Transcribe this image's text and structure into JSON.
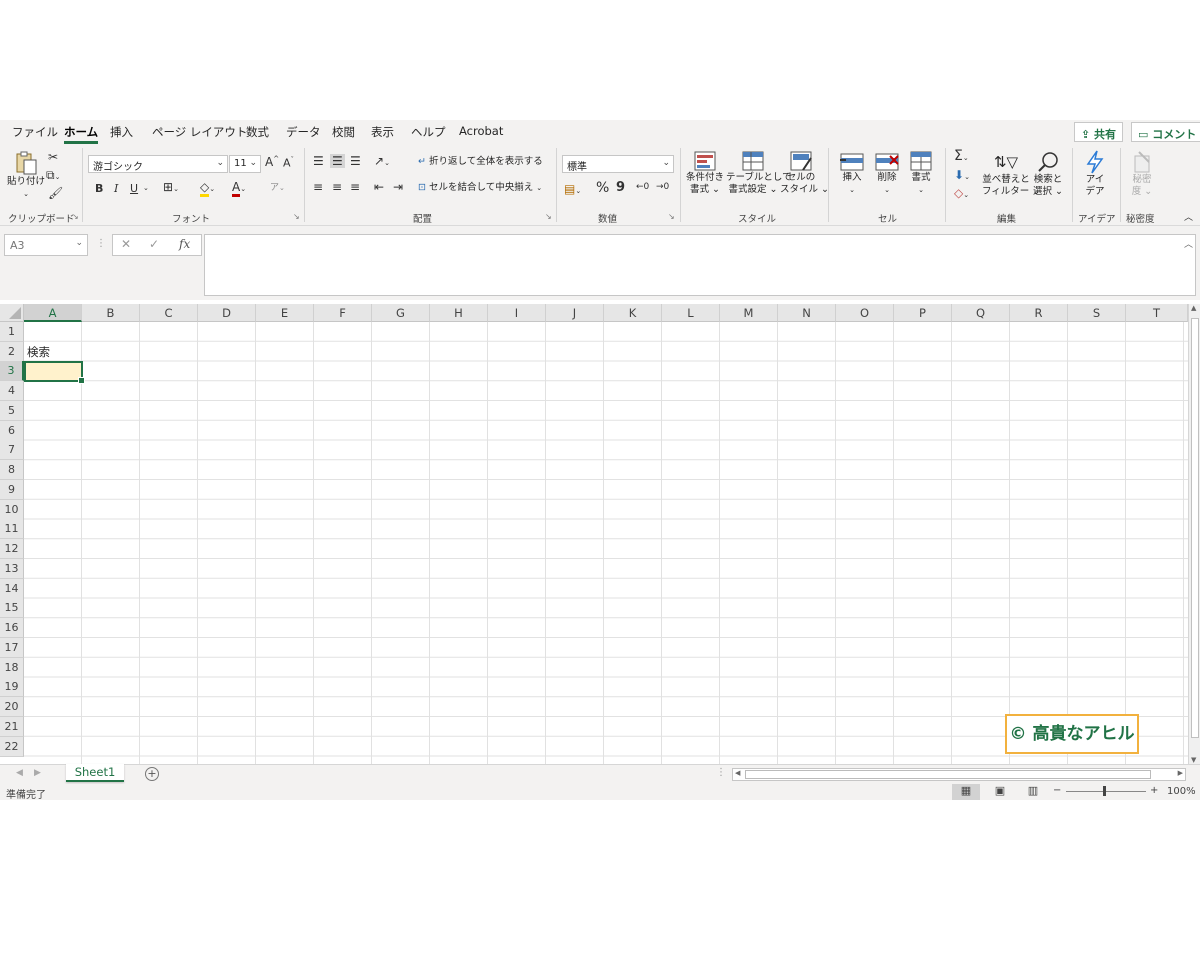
{
  "menu": {
    "tabs": [
      "ファイル",
      "ホーム",
      "挿入",
      "ページ レイアウト",
      "数式",
      "データ",
      "校閲",
      "表示",
      "ヘルプ",
      "Acrobat"
    ],
    "active_tab": "ホーム",
    "share_label": "共有",
    "comment_label": "コメント"
  },
  "ribbon": {
    "clipboard": {
      "paste_label": "貼り付け",
      "group_label": "クリップボード"
    },
    "font": {
      "font_name": "游ゴシック",
      "font_size": "11",
      "bold": "B",
      "italic": "I",
      "underline": "U",
      "group_label": "フォント"
    },
    "alignment": {
      "wrap_label": "折り返して全体を表示する",
      "merge_label": "セルを結合して中央揃え",
      "group_label": "配置"
    },
    "number": {
      "format": "標準",
      "percent": "%",
      "comma": "9",
      "group_label": "数値"
    },
    "styles": {
      "conditional_label_1": "条件付き",
      "conditional_label_2": "書式",
      "table_label_1": "テーブルとして",
      "table_label_2": "書式設定",
      "cellstyle_label_1": "セルの",
      "cellstyle_label_2": "スタイル",
      "group_label": "スタイル"
    },
    "cells": {
      "insert_label": "挿入",
      "delete_label": "削除",
      "format_label": "書式",
      "group_label": "セル"
    },
    "editing": {
      "sort_label_1": "並べ替えと",
      "sort_label_2": "フィルター",
      "find_label_1": "検索と",
      "find_label_2": "選択",
      "group_label": "編集"
    },
    "ideas": {
      "label_1": "アイ",
      "label_2": "デア",
      "group_label": "アイデア"
    },
    "sensitivity": {
      "label_1": "秘密",
      "label_2": "度",
      "group_label": "秘密度"
    }
  },
  "formula_bar": {
    "name_box": "A3",
    "fx": "fx",
    "value": ""
  },
  "grid": {
    "columns": [
      "A",
      "B",
      "C",
      "D",
      "E",
      "F",
      "G",
      "H",
      "I",
      "J",
      "K",
      "L",
      "M",
      "N",
      "O",
      "P",
      "Q",
      "R",
      "S",
      "T"
    ],
    "rows": [
      "1",
      "2",
      "3",
      "4",
      "5",
      "6",
      "7",
      "8",
      "9",
      "10",
      "11",
      "12",
      "13",
      "14",
      "15",
      "16",
      "17",
      "18",
      "19",
      "20",
      "21",
      "22"
    ],
    "selected_column": "A",
    "selected_row": "3",
    "cells": {
      "A2": "検索"
    }
  },
  "watermark": "© 高貴なアヒル",
  "sheets": {
    "tabs": [
      "Sheet1"
    ],
    "active": "Sheet1",
    "add_label": "+"
  },
  "status": {
    "text": "準備完了",
    "zoom": "100%",
    "zoom_minus": "−",
    "zoom_plus": "+"
  },
  "colors": {
    "accent": "#217346",
    "active_cell_fill": "#fff2cc",
    "watermark_border": "#f2b13e"
  }
}
